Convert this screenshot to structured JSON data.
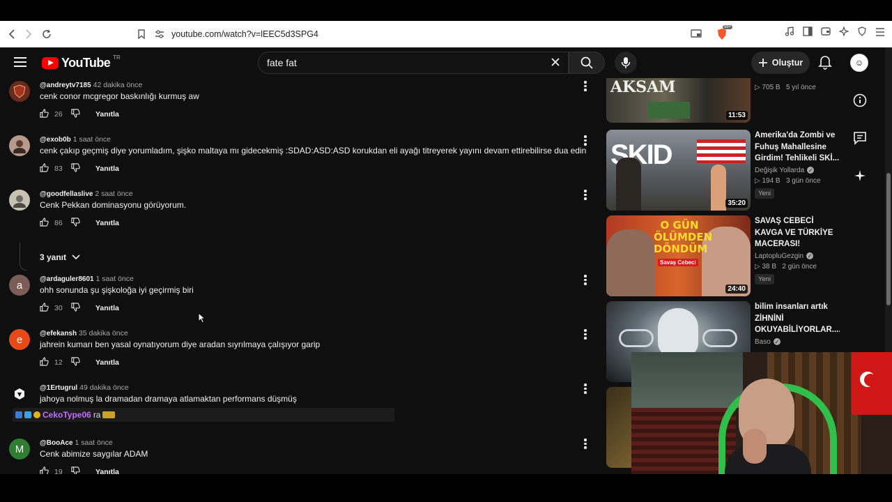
{
  "browser": {
    "url": "youtube.com/watch?v=lEEC5d3SPG4",
    "bookmark_icon": "bookmark-icon",
    "brave_badge": "99+"
  },
  "header": {
    "logo_text": "YouTube",
    "logo_region": "TR",
    "search_value": "fate fat",
    "create_label": "Oluştur"
  },
  "comments": [
    {
      "user": "@andreytv7185",
      "time": "42 dakika önce",
      "text": "cenk conor mcgregor baskınlığı kurmuş aw",
      "likes": "26",
      "reply": "Yanıtla",
      "avatar_letter": "",
      "avatar_color": "#6a2a1e"
    },
    {
      "user": "@exob0b",
      "time": "1 saat önce",
      "text": "cenk çakıp geçmiş diye yorumladım, şişko maltaya mı gidecekmiş :SDAD:ASD:ASD korukdan eli ayağı titreyerek yayını devam ettirebilirse dua edin",
      "likes": "83",
      "reply": "Yanıtla",
      "avatar_letter": "",
      "avatar_color": "#b79a8a"
    },
    {
      "user": "@goodfellaslive",
      "time": "2 saat önce",
      "text": "Cenk Pekkan dominasyonu görüyorum.",
      "likes": "86",
      "reply": "Yanıtla",
      "avatar_letter": "",
      "avatar_color": "#c8c2b5"
    },
    {
      "user": "@ardaguler8601",
      "time": "1 saat önce",
      "text": "ohh sonunda şu şişkoloğa iyi geçirmiş biri",
      "likes": "30",
      "reply": "Yanıtla",
      "avatar_letter": "a",
      "avatar_color": "#7c5c56"
    },
    {
      "user": "@efekansh",
      "time": "35 dakika önce",
      "text": "jahrein kumarı ben yasal oynatıyorum diye aradan sıyrılmaya çalışıyor garip",
      "likes": "12",
      "reply": "Yanıtla",
      "avatar_letter": "e",
      "avatar_color": "#e64a19"
    },
    {
      "user": "@1Ertugrul",
      "time": "49 dakika önce",
      "text": "jahoya nolmuş la dramadan dramaya atlamaktan performans düşmüş",
      "likes": "",
      "reply": "Yanıtla",
      "avatar_letter": "",
      "avatar_color": "#222"
    },
    {
      "user": "@BooAce",
      "time": "1 saat önce",
      "text": "Cenk abimize saygılar ADAM",
      "likes": "19",
      "reply": "Yanıtla",
      "avatar_letter": "M",
      "avatar_color": "#2e7d32"
    }
  ],
  "replies_toggle": "3 yanıt",
  "chat_overlay": {
    "name": "CekoType06",
    "suffix": "ra"
  },
  "recommendations": [
    {
      "title": "",
      "channel": "",
      "views": "705 B",
      "age": "5 yıl önce",
      "duration": "11:53",
      "thumb_text": "AKSAM",
      "new": ""
    },
    {
      "title": "Amerika'da Zombi ve Fuhuş Mahallesine Girdim! Tehlikeli SKİ...",
      "channel": "Değişik Yollarda",
      "views": "194 B",
      "age": "3 gün önce",
      "duration": "35:20",
      "thumb_text": "SKID",
      "new": "Yeni"
    },
    {
      "title": "SAVAŞ CEBECİ KAVGA VE TÜRKİYE MACERASI!",
      "channel": "LaptopluGezgin",
      "views": "38 B",
      "age": "2 gün önce",
      "duration": "24:40",
      "thumb_text": "O GÜN ÖLÜMDEN DÖNDÜM",
      "thumb_sub": "Savaş Cebeci",
      "new": "Yeni"
    },
    {
      "title": "bilim insanları artık ZİHNİNİ OKUYABİLİYORLAR.....",
      "channel": "Baso",
      "views": "",
      "age": "",
      "duration": "",
      "thumb_text": "",
      "new": ""
    }
  ],
  "colors": {
    "yt_bg": "#0f0f0f",
    "brand_red": "#ff0000",
    "text_primary": "#f1f1f1",
    "text_secondary": "#aaaaaa"
  }
}
